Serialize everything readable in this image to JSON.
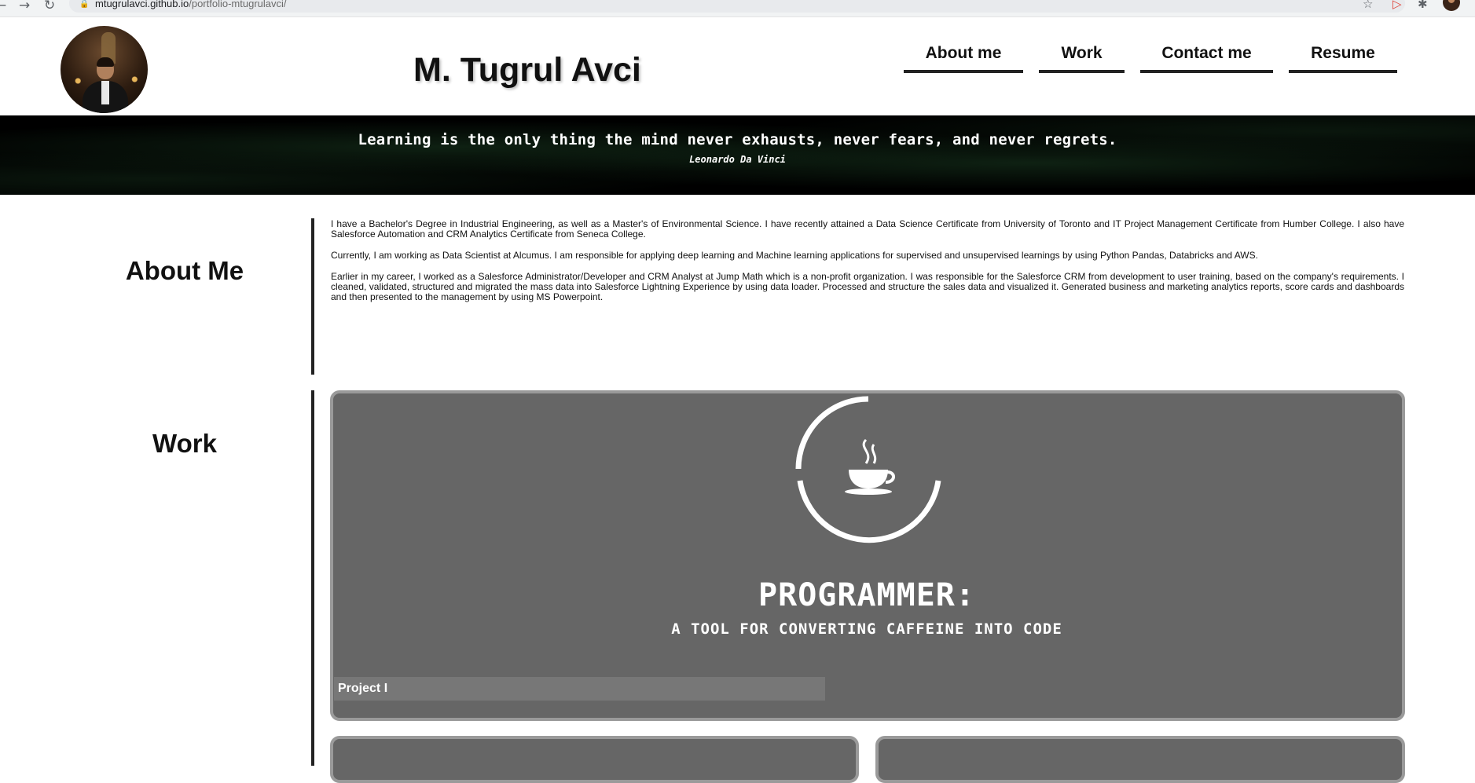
{
  "browser": {
    "url_host": "mtugrulavci.github.io",
    "url_path": "/portfolio-mtugrulavci/"
  },
  "header": {
    "title": "M. Tugrul Avci",
    "nav": [
      {
        "label": "About me"
      },
      {
        "label": "Work"
      },
      {
        "label": "Contact me"
      },
      {
        "label": "Resume"
      }
    ]
  },
  "banner": {
    "quote": "Learning is the only thing the mind never exhausts, never fears, and never regrets.",
    "author": "Leonardo Da Vinci"
  },
  "about": {
    "heading": "About Me",
    "paragraphs": [
      "I have a Bachelor's Degree in Industrial Engineering, as well as a Master's of Environmental Science. I have recently attained a Data Science Certificate from University of Toronto and IT Project Management Certificate from Humber College. I also have Salesforce Automation and CRM Analytics Certificate from Seneca College.",
      "Currently, I am working as Data Scientist at Alcumus. I am responsible for applying deep learning and Machine learning applications for supervised and unsupervised learnings by using Python Pandas, Databricks and AWS.",
      "Earlier in my career, I worked as a Salesforce Administrator/Developer and CRM Analyst at Jump Math which is a non-profit organization. I was responsible for the Salesforce CRM from development to user training, based on the company's requirements. I cleaned, validated, structured and migrated the mass data into Salesforce Lightning Experience by using data loader. Processed and structure the sales data and visualized it. Generated business and marketing analytics reports, score cards and dashboards and then presented to the management by using MS Powerpoint."
    ]
  },
  "work": {
    "heading": "Work",
    "featured": {
      "title": "PROGRAMMER:",
      "subtitle": "A TOOL FOR CONVERTING CAFFEINE INTO CODE",
      "project_label": "Project I"
    }
  }
}
